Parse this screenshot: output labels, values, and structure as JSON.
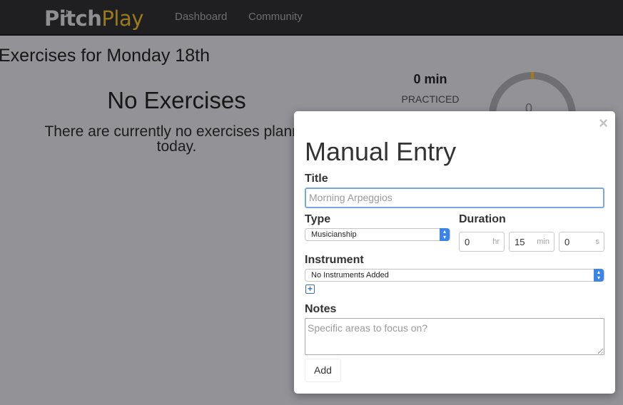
{
  "navbar": {
    "logo_pitch": "Pitch",
    "logo_play": "Play",
    "links": [
      "Dashboard",
      "Community"
    ]
  },
  "page": {
    "title": "Exercises for Monday 18th",
    "empty_heading": "No Exercises",
    "empty_text": "There are currently no exercises planne",
    "empty_text_line2": "today.",
    "stat_value": "0 min",
    "stat_label": "PRACTICED",
    "gauge_value": "0"
  },
  "modal": {
    "close": "×",
    "title": "Manual Entry",
    "fields": {
      "title_label": "Title",
      "title_placeholder": "Morning Arpeggios",
      "type_label": "Type",
      "type_value": "Musicianship",
      "duration_label": "Duration",
      "duration_hr": "0",
      "duration_hr_unit": "hr",
      "duration_min": "15",
      "duration_min_unit": "min",
      "duration_s": "0",
      "duration_s_unit": "s",
      "instrument_label": "Instrument",
      "instrument_value": "No Instruments Added",
      "notes_label": "Notes",
      "notes_placeholder": "Specific areas to focus on?"
    },
    "add_label": "Add"
  },
  "colors": {
    "accent": "#9a7a1c",
    "focus_border": "#79a6e6",
    "select_arrow": "#3b85e8"
  }
}
